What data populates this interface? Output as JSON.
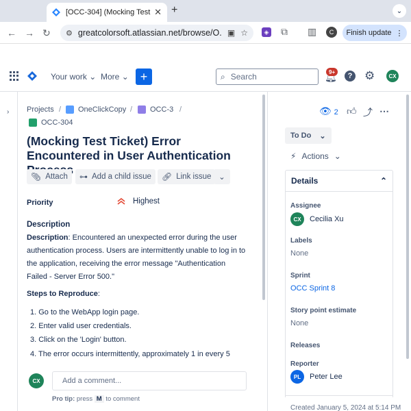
{
  "browser": {
    "tab_title": "[OCC-304] (Mocking Test Ti",
    "url": "greatcolorsoft.atlassian.net/browse/O...",
    "finish_update": "Finish update",
    "profile_initial": "C"
  },
  "jira": {
    "nav": {
      "your_work": "Your work",
      "more": "More"
    },
    "search_placeholder": "Search",
    "notifications_badge": "9+",
    "user_initials": "CX"
  },
  "breadcrumbs": {
    "projects": "Projects",
    "project": "OneClickCopy",
    "parent": "OCC-3",
    "issue_key": "OCC-304"
  },
  "issue": {
    "title": "(Mocking Test Ticket) Error Encountered in User Authentication Process",
    "buttons": {
      "attach": "Attach",
      "child": "Add a child issue",
      "link": "Link issue"
    },
    "priority_label": "Priority",
    "priority_value": "Highest",
    "description_heading": "Description",
    "description_bold": "Description",
    "description_text": ": Encountered an unexpected error during the user authentication process. Users are intermittently unable to log in to the application, receiving the error message \"Authentication Failed - Server Error 500.\"",
    "steps_heading": "Steps to Reproduce",
    "steps_colon": ":",
    "steps": [
      "1. Go to the WebApp login page.",
      "2. Enter valid user credentials.",
      "3. Click on the 'Login' button.",
      "4. The error occurs intermittently, approximately 1 in every 5"
    ],
    "comment_placeholder": "Add a comment...",
    "pro_tip_prefix": "Pro tip:",
    "pro_tip_press": "press",
    "pro_tip_key": "M",
    "pro_tip_suffix": "to comment"
  },
  "side": {
    "watchers": "2",
    "status": "To Do",
    "actions": "Actions",
    "details": "Details",
    "assignee_label": "Assignee",
    "assignee": "Cecilia Xu",
    "assignee_initials": "CX",
    "labels_label": "Labels",
    "labels_value": "None",
    "sprint_label": "Sprint",
    "sprint_value": "OCC Sprint 8",
    "story_label": "Story point estimate",
    "story_value": "None",
    "releases_label": "Releases",
    "reporter_label": "Reporter",
    "reporter": "Peter Lee",
    "reporter_initials": "PL",
    "created": "Created January 5, 2024 at 5:14 PM"
  },
  "colors": {
    "primary": "#0c66e4",
    "assignee_avatar": "#1f845a",
    "reporter_avatar": "#0c66e4",
    "badge": "#c9372c"
  }
}
